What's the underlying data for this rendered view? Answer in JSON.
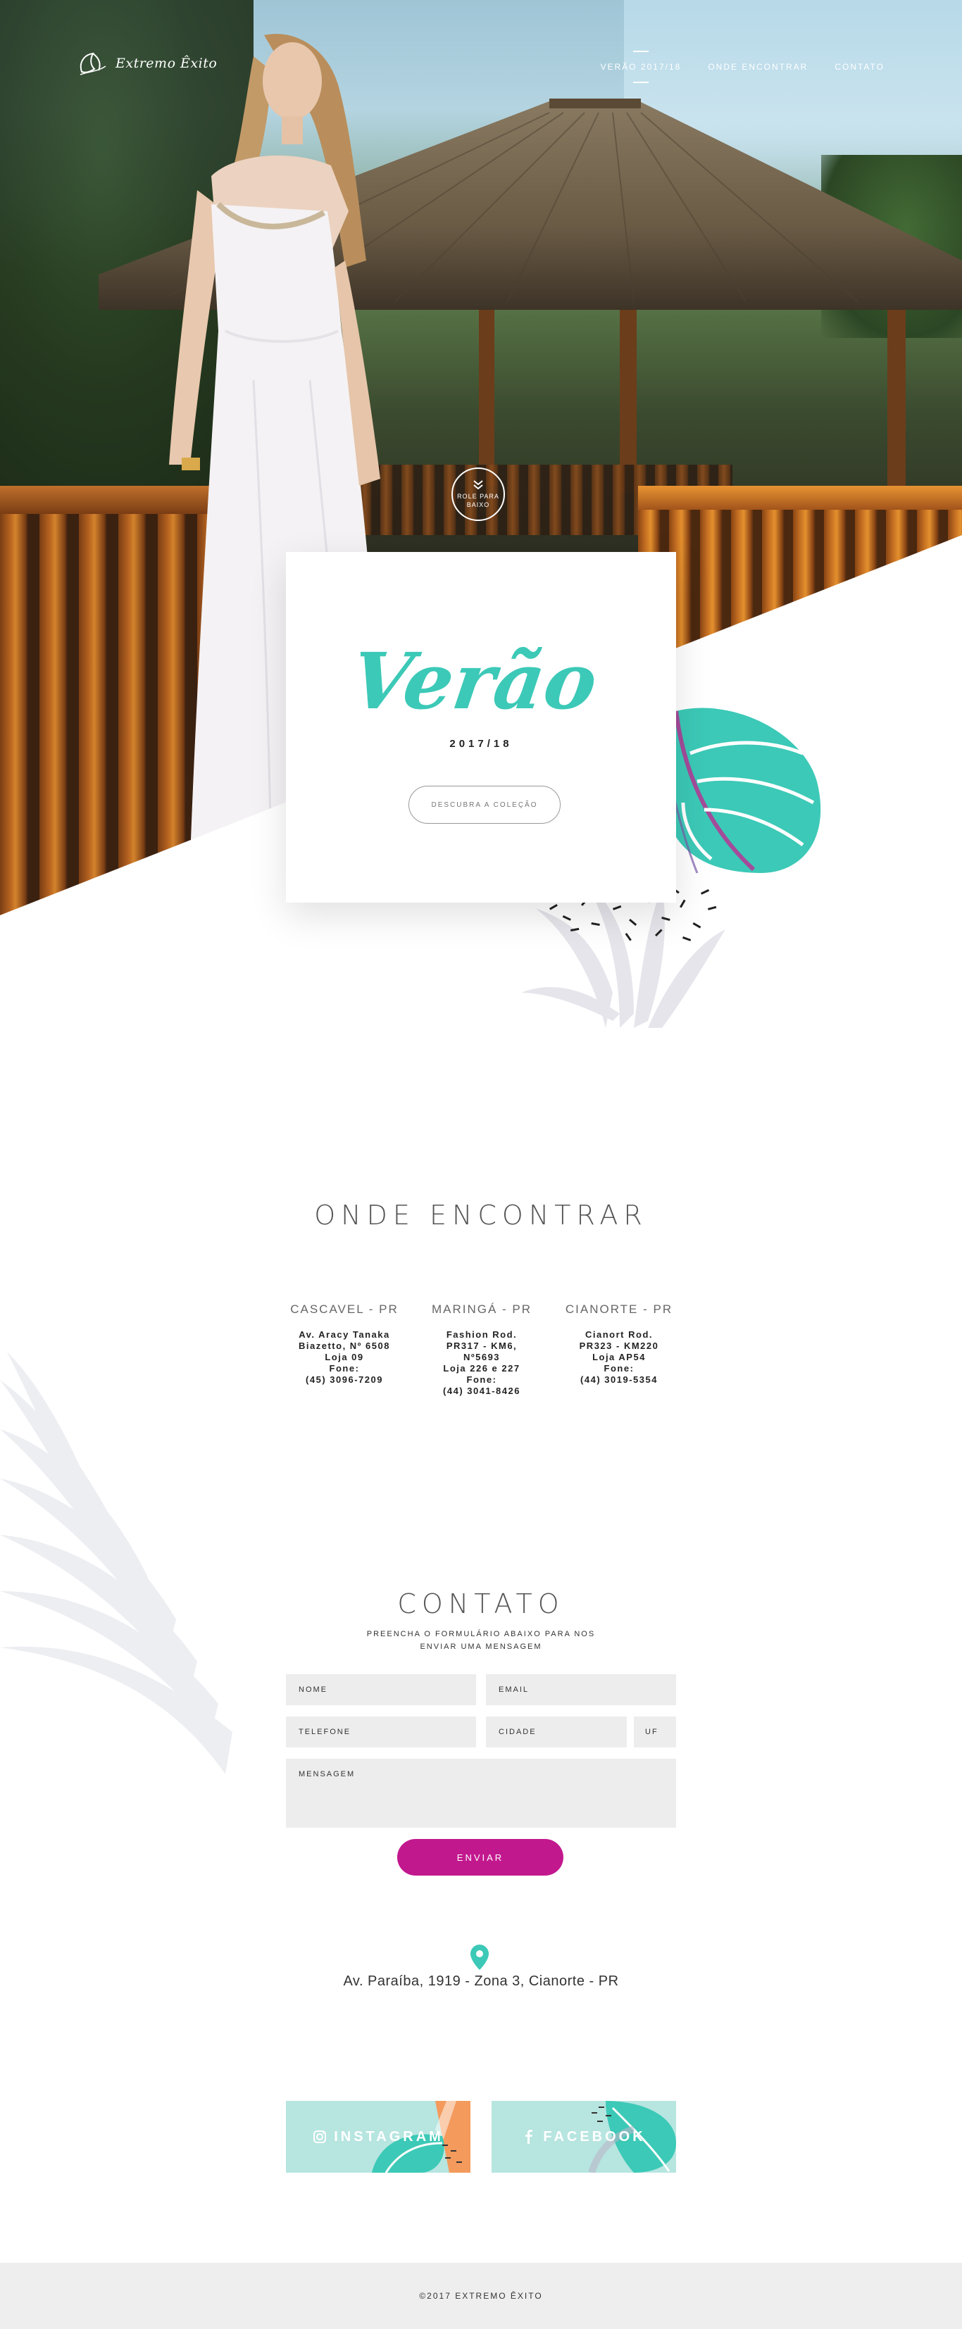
{
  "brand": {
    "name": "Extremo Êxito"
  },
  "nav": {
    "items": [
      {
        "label": "VERÃO 2017/18",
        "active": true
      },
      {
        "label": "ONDE ENCONTRAR",
        "active": false
      },
      {
        "label": "CONTATO",
        "active": false
      }
    ]
  },
  "hero": {
    "scroll_label_1": "ROLE PARA",
    "scroll_label_2": "BAIXO",
    "collection_title": "Verão",
    "collection_year": "2017/18",
    "cta_label": "DESCUBRA A COLEÇÃO"
  },
  "stores_section": {
    "title": "ONDE ENCONTRAR",
    "stores": [
      {
        "city": "CASCAVEL - PR",
        "lines": [
          "Av. Aracy Tanaka",
          "Biazetto, Nº 6508",
          "Loja 09",
          "Fone:",
          "(45) 3096-7209"
        ]
      },
      {
        "city": "MARINGÁ - PR",
        "lines": [
          "Fashion Rod.",
          "PR317 - KM6,",
          "Nº5693",
          "Loja 226 e 227",
          "Fone:",
          "(44) 3041-8426"
        ]
      },
      {
        "city": "CIANORTE - PR",
        "lines": [
          "Cianort Rod.",
          "PR323 - KM220",
          "Loja AP54",
          "Fone:",
          "(44) 3019-5354"
        ]
      }
    ]
  },
  "contact": {
    "title": "CONTATO",
    "subtitle_1": "PREENCHA O FORMULÁRIO ABAIXO PARA NOS",
    "subtitle_2": "ENVIAR UMA MENSAGEM",
    "fields": {
      "name": "NOME",
      "email": "EMAIL",
      "phone": "TELEFONE",
      "city": "CIDADE",
      "state": "UF",
      "message": "MENSAGEM"
    },
    "submit_label": "ENVIAR",
    "accent_color": "#c2188e"
  },
  "location": {
    "icon": "map-pin-icon",
    "address": "Av. Paraíba, 1919 - Zona 3, Cianorte - PR"
  },
  "social": {
    "instagram": {
      "label": "INSTAGRAM",
      "icon": "instagram-icon"
    },
    "facebook": {
      "label": "FACEBOOK",
      "icon": "facebook-icon"
    }
  },
  "footer": {
    "copyright": "©2017 EXTREMO ÊXITO"
  },
  "colors": {
    "teal": "#3cc9b7",
    "magenta": "#c2188e",
    "field_bg": "#ededed"
  }
}
